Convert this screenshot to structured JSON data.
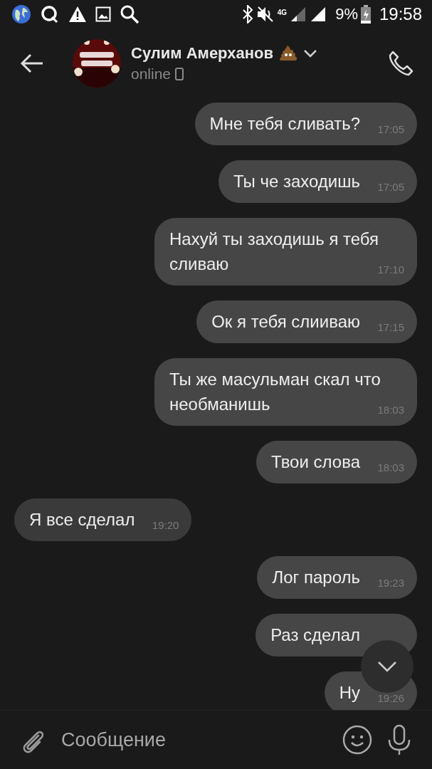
{
  "status_bar": {
    "network": "4G",
    "battery": "9%",
    "time": "19:58"
  },
  "header": {
    "name": "Сулим Амерханов",
    "status": "online"
  },
  "messages": [
    {
      "kind": "out",
      "text": "Мне тебя сливать?",
      "time": "17:05"
    },
    {
      "kind": "out",
      "text": "Ты че заходишь",
      "time": "17:05"
    },
    {
      "kind": "out",
      "text": "Нахуй ты заходишь я тебя сливаю",
      "time": "17:10"
    },
    {
      "kind": "out",
      "text": "Ок я тебя слииваю",
      "time": "17:15"
    },
    {
      "kind": "out",
      "text": "Ты же масульман скал что необманишь",
      "time": "18:03"
    },
    {
      "kind": "out",
      "text": "Твои слова",
      "time": "18:03"
    },
    {
      "kind": "in",
      "text": "Я все сделал",
      "time": "19:20"
    },
    {
      "kind": "out",
      "text": "Лог пароль",
      "time": "19:23"
    },
    {
      "kind": "out",
      "text": "Раз сделал"
    },
    {
      "kind": "out",
      "text": "Ну",
      "time": "19:26"
    }
  ],
  "composer": {
    "placeholder": "Сообщение"
  }
}
